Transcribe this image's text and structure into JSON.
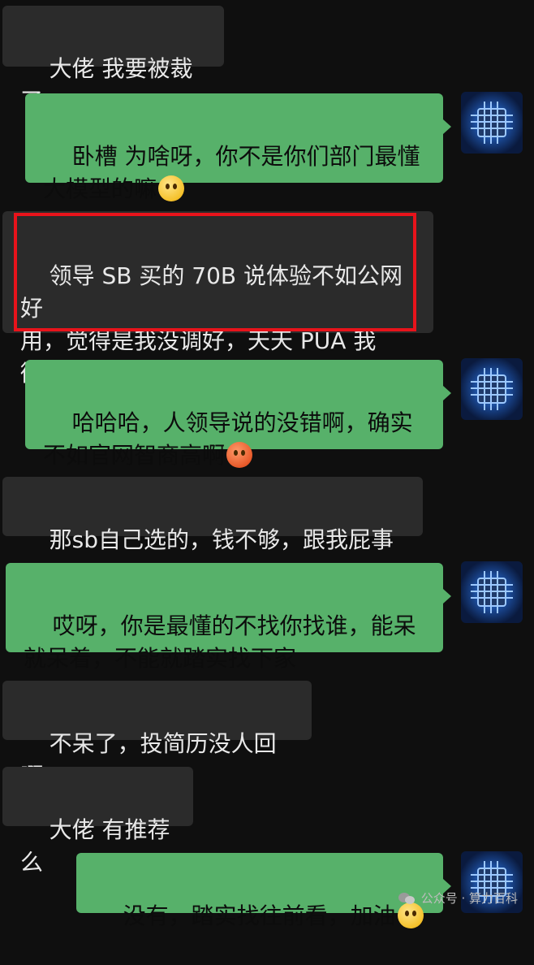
{
  "messages": [
    {
      "side": "left",
      "text": "大佬 我要被裁了",
      "emoji": ""
    },
    {
      "side": "right",
      "text": "卧槽 为啥呀，你不是你们部门最懂\n大模型的嘛",
      "emoji": "crying-face"
    },
    {
      "side": "left",
      "text": "领导 SB 买的 70B 说体验不如公网好\n用，觉得是我没调好，天天 PUA 我\n微调，老子不干了",
      "emoji": ""
    },
    {
      "side": "right",
      "text": "哈哈哈，人领导说的没错啊，确实\n不如官网智商高啊",
      "emoji": "hot-face"
    },
    {
      "side": "left",
      "text": "那sb自己选的，钱不够，跟我屁事",
      "emoji": ""
    },
    {
      "side": "right",
      "text": "哎呀，你是最懂的不找你找谁，能呆\n就呆着，不能就踏实找下家",
      "emoji": ""
    },
    {
      "side": "left",
      "text": "不呆了，投简历没人回啊",
      "emoji": ""
    },
    {
      "side": "left",
      "text": "大佬 有推荐么",
      "emoji": ""
    },
    {
      "side": "right",
      "text": "没有，踏实找往前看，加油",
      "emoji": "grinning-face"
    }
  ],
  "highlight_color": "#e8131b",
  "watermark": {
    "label": "公众号 · 算力百科",
    "icon": "wechat-icon"
  },
  "colors": {
    "background": "#0f0f0f",
    "left_bubble": "#2b2b2b",
    "right_bubble": "#57b16a"
  }
}
